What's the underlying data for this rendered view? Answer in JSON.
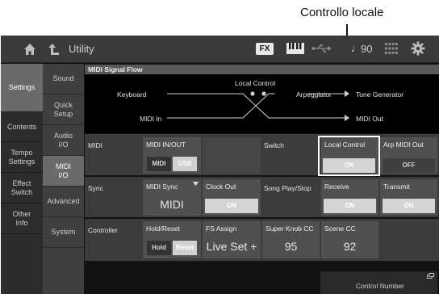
{
  "callout": {
    "label": "Controllo locale"
  },
  "topbar": {
    "title": "Utility",
    "fx": "FX",
    "note_glyph": "♩",
    "tempo": "90"
  },
  "sidebar_main": [
    {
      "label": "Settings",
      "active": true
    },
    {
      "label": "Contents",
      "active": false
    },
    {
      "label": "Tempo Settings",
      "active": false
    },
    {
      "label": "Effect Switch",
      "active": false
    },
    {
      "label": "Other Info",
      "active": false
    }
  ],
  "sidebar_sub": [
    {
      "label": "Sound",
      "active": false
    },
    {
      "label": "Quick Setup",
      "active": false
    },
    {
      "label": "Audio I/O",
      "active": false
    },
    {
      "label": "MIDI I/O",
      "active": true
    },
    {
      "label": "Advanced",
      "active": false
    },
    {
      "label": "System",
      "active": false
    }
  ],
  "signal_flow": {
    "title": "MIDI Signal Flow",
    "keyboard": "Keyboard",
    "local_control": "Local Control",
    "arpeggiator": "Arpeggiator",
    "tone_generator": "Tone Generator",
    "midi_in": "MIDI In",
    "midi_out": "MIDI Out"
  },
  "midi_row": {
    "label": "MIDI",
    "io_label": "MIDI IN/OUT",
    "io_options": [
      "MIDI",
      "USB"
    ],
    "switch_label": "Switch",
    "local_control_label": "Local Control",
    "local_control_value": "ON",
    "arp_out_label": "Arp MIDI Out",
    "arp_out_value": "OFF"
  },
  "sync_row": {
    "label": "Sync",
    "midi_sync_label": "MIDI Sync",
    "midi_sync_value": "MIDI",
    "clock_out_label": "Clock Out",
    "clock_out_value": "ON",
    "song_play_label": "Song Play/Stop",
    "receive_label": "Receive",
    "receive_value": "ON",
    "transmit_label": "Transmit",
    "transmit_value": "ON"
  },
  "controller_row": {
    "label": "Controller",
    "hold_reset_label": "Hold/Reset",
    "hold_reset_options": [
      "Hold",
      "Reset"
    ],
    "fs_assign_label": "FS Assign",
    "fs_assign_value": "Live Set +",
    "super_knob_label": "Super Knob CC",
    "super_knob_value": "95",
    "scene_cc_label": "Scene CC",
    "scene_cc_value": "92",
    "control_number_label": "Control Number"
  }
}
